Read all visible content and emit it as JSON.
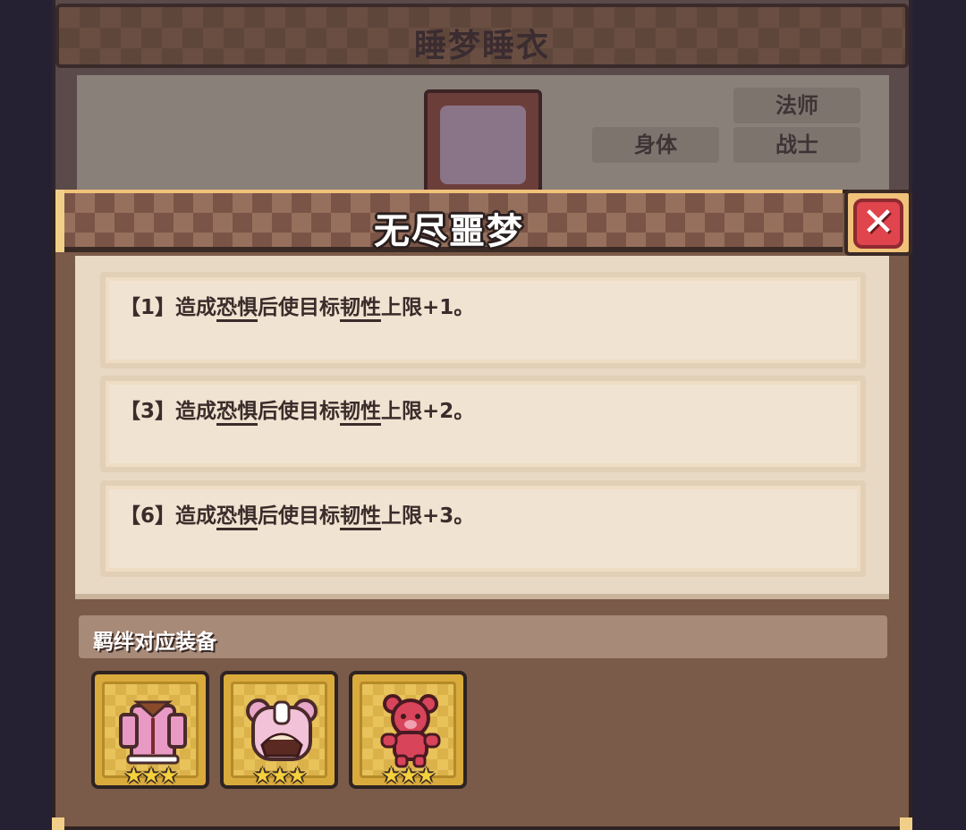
{
  "background_panel": {
    "title": "睡梦睡衣",
    "tags": [
      "法师",
      "身体",
      "战士"
    ]
  },
  "popup": {
    "title": "无尽噩梦",
    "close_label": "✕",
    "effects": [
      {
        "tier": "【1】",
        "pre": "造成",
        "kw1": "恐惧",
        "mid": "后使目标",
        "kw2": "韧性",
        "post": "上限+1。"
      },
      {
        "tier": "【3】",
        "pre": "造成",
        "kw1": "恐惧",
        "mid": "后使目标",
        "kw2": "韧性",
        "post": "上限+2。"
      },
      {
        "tier": "【6】",
        "pre": "造成",
        "kw1": "恐惧",
        "mid": "后使目标",
        "kw2": "韧性",
        "post": "上限+3。"
      }
    ],
    "section_label": "羁绊对应装备",
    "equipment": [
      {
        "icon": "pink-pajama-robe-icon",
        "stars": "★★★"
      },
      {
        "icon": "bear-nightcap-icon",
        "stars": "★★★"
      },
      {
        "icon": "red-teddy-bear-icon",
        "stars": "★★★"
      }
    ]
  }
}
